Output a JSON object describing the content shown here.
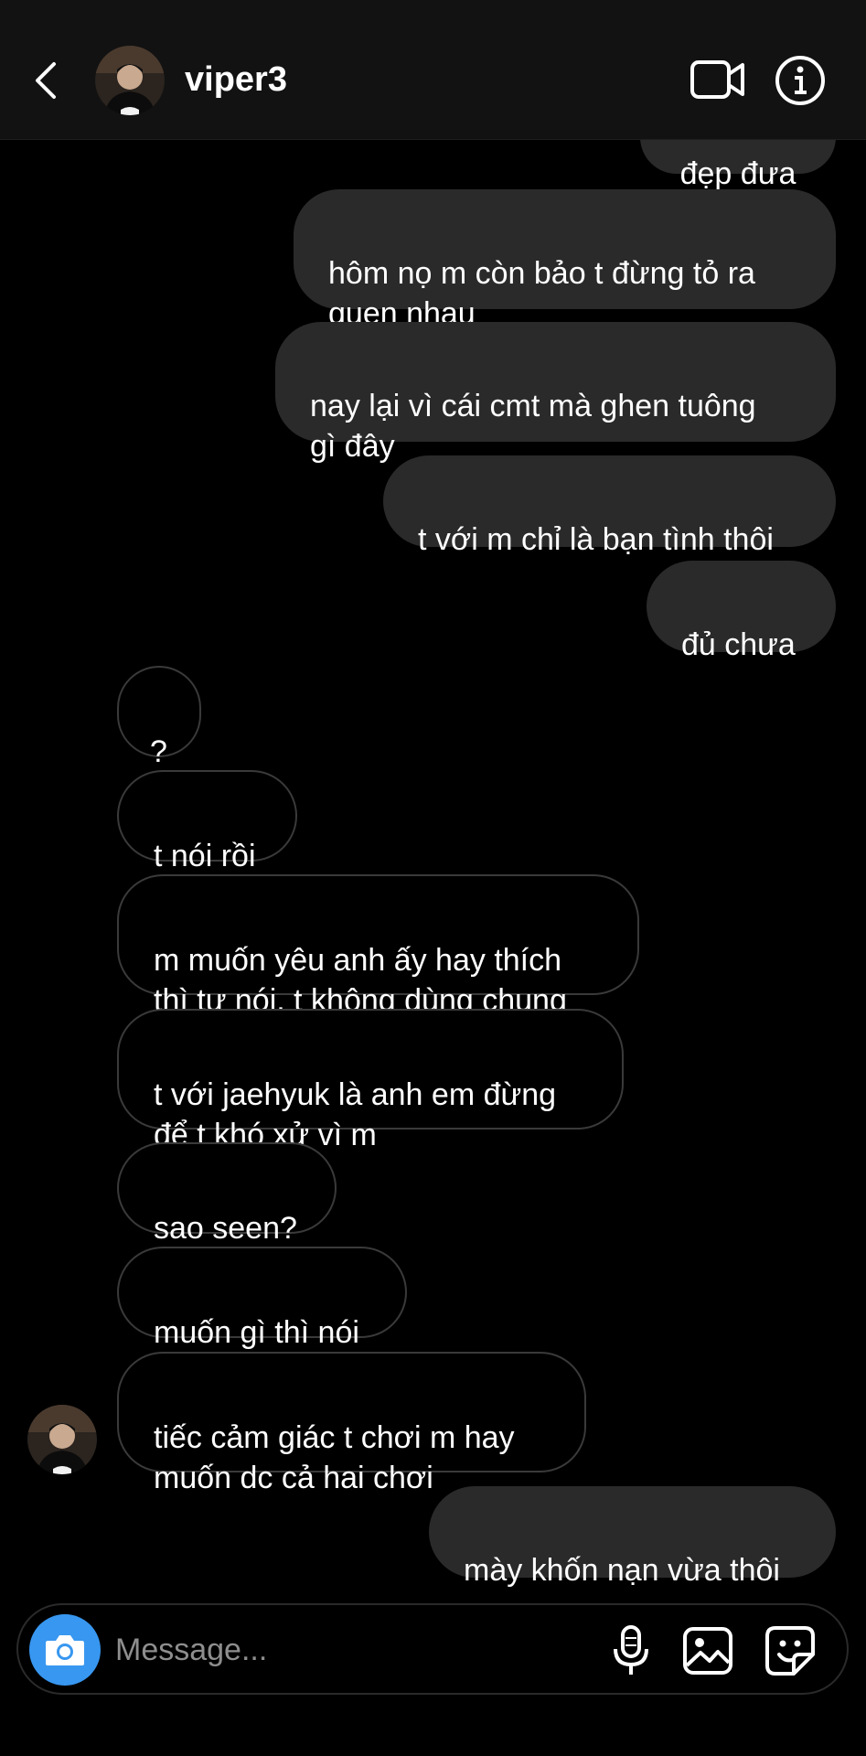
{
  "header": {
    "username": "viper3"
  },
  "messages": {
    "partial_out": "đẹp đưa",
    "out1": "hôm nọ m còn bảo t đừng tỏ ra\nquen nhau",
    "out2": "nay lại vì cái cmt mà ghen tuông\ngì đây",
    "out3": "t với m chỉ là bạn tình thôi",
    "out4": "đủ chưa",
    "in1": "?",
    "in2": "t nói rồi",
    "in3": "m muốn yêu anh ấy hay thích\nthì tự nói, t không dùng chung",
    "in4": "t với jaehyuk là anh em đừng\nđể t khó xử vì m",
    "in5": "sao seen?",
    "in6": "muốn gì thì nói",
    "in7": "tiếc cảm giác t chơi m hay\nmuốn dc cả hai chơi",
    "out5": "mày khốn nạn vừa thôi"
  },
  "composer": {
    "placeholder": "Message..."
  },
  "colors": {
    "accent": "#3897f0",
    "outgoing_bubble": "#2a2a2a",
    "incoming_border": "#3a3a3a",
    "background": "#000000"
  },
  "icons": [
    "back-icon",
    "video-call-icon",
    "info-icon",
    "camera-icon",
    "microphone-icon",
    "gallery-icon",
    "sticker-icon"
  ]
}
